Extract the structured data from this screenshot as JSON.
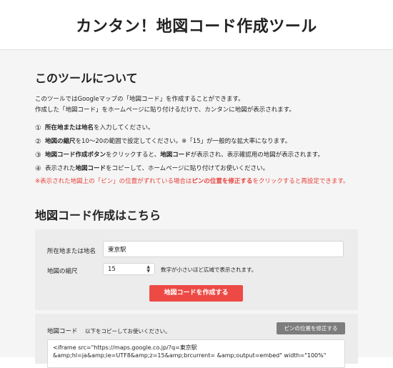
{
  "header": {
    "title": "カンタン！地図コード作成ツール"
  },
  "about": {
    "title": "このツールについて",
    "intro_line1": "このツールではGoogleマップの「地図コード」を作成することができます。",
    "intro_line2": "作成した「地図コード」をホームページに貼り付けるだけで、カンタンに地図が表示されます。",
    "steps": [
      {
        "num": "①",
        "bold1": "所在地または地名",
        "text1": "を入力してください。",
        "bold2": "",
        "text2": ""
      },
      {
        "num": "②",
        "bold1": "地図の縮尺",
        "text1": "を10〜20の範囲で設定してください。※「15」が一般的な拡大率になります。",
        "bold2": "",
        "text2": ""
      },
      {
        "num": "③",
        "bold1": "地図コード作成ボタン",
        "text1": "をクリックすると、",
        "bold2": "地図コード",
        "text2": "が表示され、表示確認用の地図が表示されます。"
      },
      {
        "num": "④",
        "pre": "表示された",
        "bold1": "地図コード",
        "text1": "をコピーして、ホームページに貼り付けてお使いください。"
      }
    ],
    "warning_pre": "※表示された地図上の「ピン」の位置がずれている場合は",
    "warning_bold": "ピンの位置を修正する",
    "warning_post": "をクリックすると再設定できます。"
  },
  "create": {
    "title": "地図コード作成はこちら",
    "address_label": "所在地または地名",
    "address_value": "東京駅",
    "zoom_label": "地図の縮尺",
    "zoom_value": "15",
    "zoom_hint": "数字が小さいほど広域で表示されます。",
    "create_button": "地図コードを作成する"
  },
  "code": {
    "label": "地図コード",
    "sub": "以下をコピーしてお使いください。",
    "fix_button": "ピンの位置を修正する",
    "value": "<iframe src=\"https://maps.google.co.jp/?q=東京駅\n&amp;hl=ja&amp;ie=UTF8&amp;z=15&amp;brcurrent= &amp;output=embed\" width=\"100%\""
  },
  "icons": {
    "select_arrow": "updown-arrow-icon"
  }
}
